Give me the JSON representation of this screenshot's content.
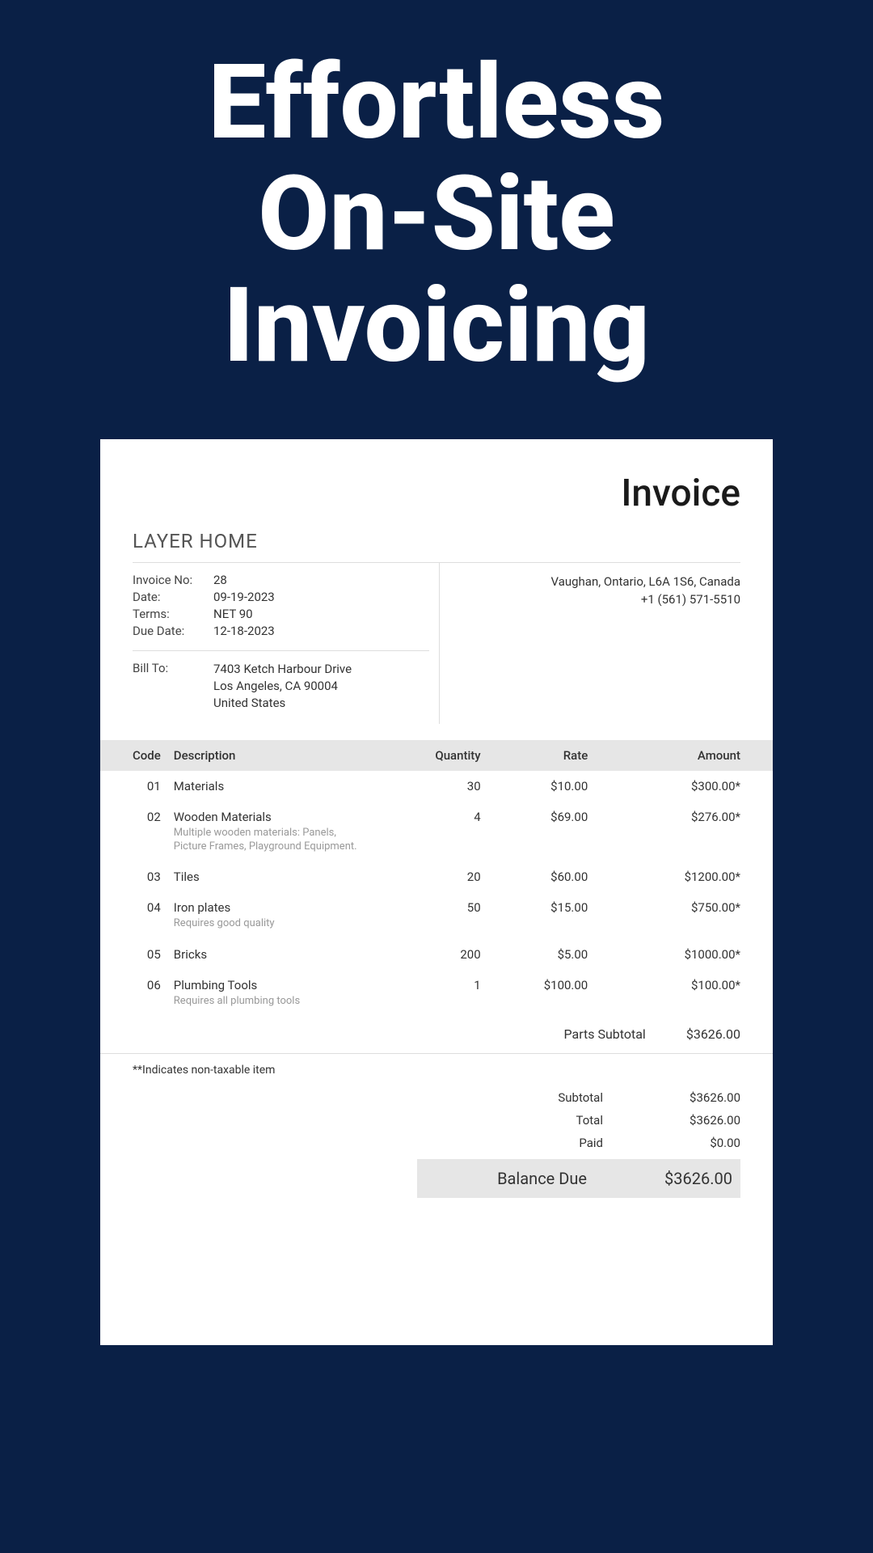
{
  "headline": {
    "l1": "Effortless",
    "l2": "On-Site",
    "l3": "Invoicing"
  },
  "doc": {
    "title": "Invoice",
    "company": "LAYER HOME",
    "labels": {
      "invoice_no": "Invoice No:",
      "date": "Date:",
      "terms": "Terms:",
      "due": "Due Date:",
      "bill_to": "Bill To:"
    },
    "meta": {
      "invoice_no": "28",
      "date": "09-19-2023",
      "terms": "NET 90",
      "due": "12-18-2023"
    },
    "bill_to": {
      "line1": "7403 Ketch Harbour Drive",
      "line2": "Los Angeles, CA 90004",
      "line3": "United States"
    },
    "from": {
      "line1": "Vaughan, Ontario, L6A 1S6, Canada",
      "line2": "+1 (561) 571-5510"
    },
    "cols": {
      "code": "Code",
      "desc": "Description",
      "qty": "Quantity",
      "rate": "Rate",
      "amount": "Amount"
    },
    "items": [
      {
        "code": "01",
        "desc": "Materials",
        "sub": "",
        "qty": "30",
        "rate": "$10.00",
        "amount": "$300.00*"
      },
      {
        "code": "02",
        "desc": "Wooden Materials",
        "sub": "Multiple wooden materials: Panels, Picture Frames, Playground Equipment.",
        "qty": "4",
        "rate": "$69.00",
        "amount": "$276.00*"
      },
      {
        "code": "03",
        "desc": "Tiles",
        "sub": "",
        "qty": "20",
        "rate": "$60.00",
        "amount": "$1200.00*"
      },
      {
        "code": "04",
        "desc": "Iron plates",
        "sub": "Requires good quality",
        "qty": "50",
        "rate": "$15.00",
        "amount": "$750.00*"
      },
      {
        "code": "05",
        "desc": "Bricks",
        "sub": "",
        "qty": "200",
        "rate": "$5.00",
        "amount": "$1000.00*"
      },
      {
        "code": "06",
        "desc": "Plumbing Tools",
        "sub": "Requires all plumbing tools",
        "qty": "1",
        "rate": "$100.00",
        "amount": "$100.00*"
      }
    ],
    "parts_subtotal": {
      "label": "Parts Subtotal",
      "value": "$3626.00"
    },
    "note": "**Indicates non-taxable item",
    "totals": {
      "subtotal": {
        "label": "Subtotal",
        "value": "$3626.00"
      },
      "total": {
        "label": "Total",
        "value": "$3626.00"
      },
      "paid": {
        "label": "Paid",
        "value": "$0.00"
      },
      "balance": {
        "label": "Balance Due",
        "value": "$3626.00"
      }
    }
  }
}
